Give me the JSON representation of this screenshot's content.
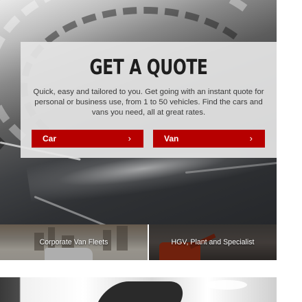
{
  "quote": {
    "title": "GET A QUOTE",
    "description": "Quick, easy and tailored to you. Get going with an instant quote for personal or business use, from 1 to 50 vehicles. Find the cars and vans you need, all at great rates.",
    "buttons": [
      {
        "label": "Car",
        "icon": "chevron-right-icon",
        "glyph": "›"
      },
      {
        "label": "Van",
        "icon": "chevron-right-icon",
        "glyph": "›"
      }
    ]
  },
  "categories": [
    {
      "label": "Corporate Van Fleets"
    },
    {
      "label": "HGV, Plant and Specialist"
    }
  ],
  "colors": {
    "accent": "#b70000",
    "panel": "#e5e5e5",
    "title_text": "#1e1e1e"
  }
}
